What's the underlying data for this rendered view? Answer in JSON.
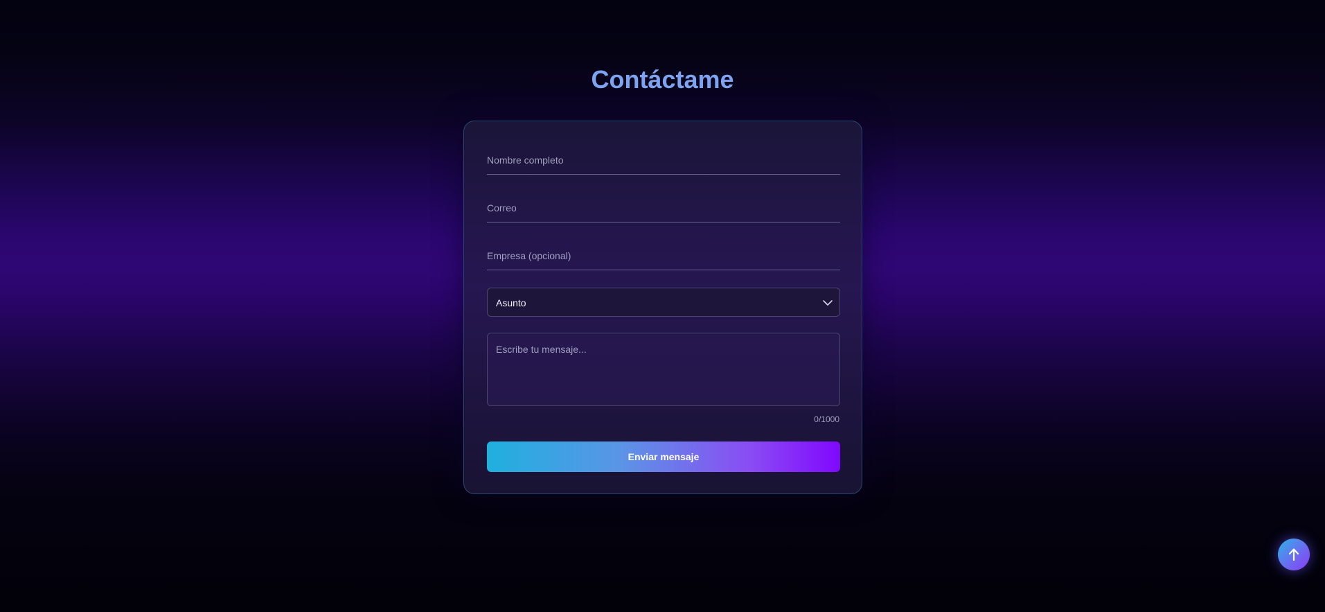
{
  "page": {
    "title": "Contáctame"
  },
  "form": {
    "name_placeholder": "Nombre completo",
    "email_placeholder": "Correo",
    "company_placeholder": "Empresa (opcional)",
    "subject_value": "Asunto",
    "message_placeholder": "Escribe tu mensaje...",
    "char_counter": "0/1000",
    "submit_label": "Enviar mensaje"
  },
  "icons": {
    "select_chevron": "chevron-down-icon",
    "scroll_top": "arrow-up-icon"
  },
  "colors": {
    "title": "#7ea4f1",
    "button_gradient_start": "#1fb0df",
    "button_gradient_end": "#8008ff",
    "card_border": "#28496e"
  }
}
